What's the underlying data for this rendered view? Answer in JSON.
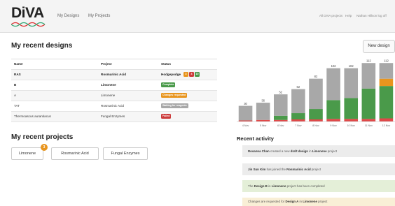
{
  "header": {
    "logo": "DiVA",
    "nav": [
      "My Designs",
      "My Projects"
    ],
    "right": [
      "All DIVA projects",
      "Help",
      "Nathan Hillson log off"
    ]
  },
  "designs": {
    "title": "My recent designs",
    "new_button": "New design",
    "columns": [
      "Name",
      "Project",
      "Status"
    ],
    "rows": [
      {
        "name": "RAS",
        "project": "Rosmarinic Acid",
        "status": "Hodgepodge",
        "mini": [
          "3",
          "4",
          "10"
        ]
      },
      {
        "name": "B",
        "project": "Limonene",
        "status": "Complete"
      },
      {
        "name": "A",
        "project": "Limonene",
        "status": "Changes requested"
      },
      {
        "name": "TAT",
        "project": "Rosmarinic Acid",
        "status": "Waiting for reagents"
      },
      {
        "name": "Thermoascus aurantiacus",
        "project": "Fungal Enzymes",
        "status": "Failed"
      }
    ]
  },
  "projects": {
    "title": "My recent projects",
    "items": [
      "Limonene",
      "Rosmarinic Acid",
      "Fungal Enzymes"
    ],
    "limonene_badge": "3"
  },
  "chart_data": {
    "type": "bar",
    "stacked": true,
    "categories": [
      "4 Nov",
      "5 Nov",
      "6 Nov",
      "7 Nov",
      "8 Nov",
      "9 Nov",
      "10 Nov",
      "11 Nov",
      "12 Nov"
    ],
    "totals": [
      "30",
      "36",
      "52",
      "62",
      "82",
      "102",
      "102",
      "112",
      "112"
    ],
    "series": [
      {
        "color": "#e04848",
        "values": [
          2,
          3,
          3,
          4,
          4,
          5,
          5,
          5,
          6
        ]
      },
      {
        "color": "#4a9a4a",
        "values": [
          0,
          0,
          8,
          12,
          20,
          36,
          40,
          58,
          62
        ]
      },
      {
        "color": "#e8951e",
        "values": [
          0,
          0,
          0,
          0,
          0,
          0,
          0,
          0,
          14
        ]
      },
      {
        "color": "#a8a8a8",
        "values": [
          28,
          33,
          41,
          46,
          58,
          61,
          57,
          49,
          30
        ]
      }
    ],
    "ylim": [
      0,
      115
    ]
  },
  "activity": {
    "title": "Recent activity",
    "items": [
      {
        "pre": "",
        "b1": "Rosanna Chan",
        "mid": " created a new ",
        "b2": "draft design",
        "mid2": " in ",
        "b3": "Limonene",
        "post": " project",
        "bg": "#ececec"
      },
      {
        "pre": "",
        "b1": "Jin Sun Kim",
        "mid": " has joined the ",
        "b2": "Rosmarinic Acid",
        "mid2": " project",
        "b3": "",
        "post": "",
        "bg": "#ececec"
      },
      {
        "pre": "The ",
        "b1": "Design B",
        "mid": " in ",
        "b2": "Limonene",
        "mid2": " project has been completed",
        "b3": "",
        "post": "",
        "bg": "#e4efd8"
      },
      {
        "pre": "Changes are requested for ",
        "b1": "Design A",
        "mid": " in ",
        "b2": "Limonene",
        "mid2": " project",
        "b3": "",
        "post": "",
        "bg": "#f9efd6"
      }
    ]
  },
  "colors": {
    "complete": "#4a9a4a",
    "changes": "#e8951e",
    "waiting": "#a8a8a8",
    "failed": "#cc3b3b",
    "hodgepodge_mini": [
      "#e8951e",
      "#cc3b3b",
      "#4a9a4a"
    ]
  }
}
